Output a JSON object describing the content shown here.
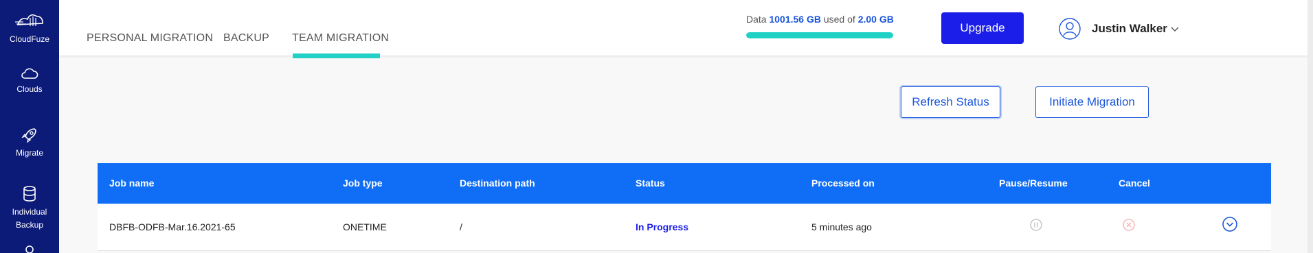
{
  "sidebar": {
    "logo_label": "CloudFuze",
    "items": [
      {
        "label": "Clouds",
        "icon": "cloud-icon"
      },
      {
        "label": "Migrate",
        "icon": "rocket-icon"
      },
      {
        "label_line1": "Individual",
        "label_line2": "Backup",
        "icon": "database-icon"
      }
    ]
  },
  "tabs": [
    {
      "label": "PERSONAL MIGRATION",
      "active": false
    },
    {
      "label": "BACKUP",
      "active": false
    },
    {
      "label": "TEAM MIGRATION",
      "active": true
    }
  ],
  "usage": {
    "prefix": "Data",
    "used": "1001.56 GB",
    "middle": "used of",
    "total": "2.00 GB",
    "fill_fraction": 1.0
  },
  "upgrade_label": "Upgrade",
  "user": {
    "name": "Justin Walker"
  },
  "actions": {
    "refresh_label": "Refresh Status",
    "initiate_label": "Initiate Migration"
  },
  "table": {
    "headers": {
      "job_name": "Job name",
      "job_type": "Job type",
      "destination": "Destination path",
      "status": "Status",
      "processed": "Processed on",
      "pause": "Pause/Resume",
      "cancel": "Cancel"
    },
    "rows": [
      {
        "job_name": "DBFB-ODFB-Mar.16.2021-65",
        "job_type": "ONETIME",
        "destination": "/",
        "status": "In Progress",
        "processed": "5 minutes ago"
      }
    ]
  },
  "colors": {
    "sidebar": "#0c1a78",
    "accent_teal": "#22d1c6",
    "primary_blue": "#1b1ee9",
    "table_header": "#0f6ef5"
  }
}
